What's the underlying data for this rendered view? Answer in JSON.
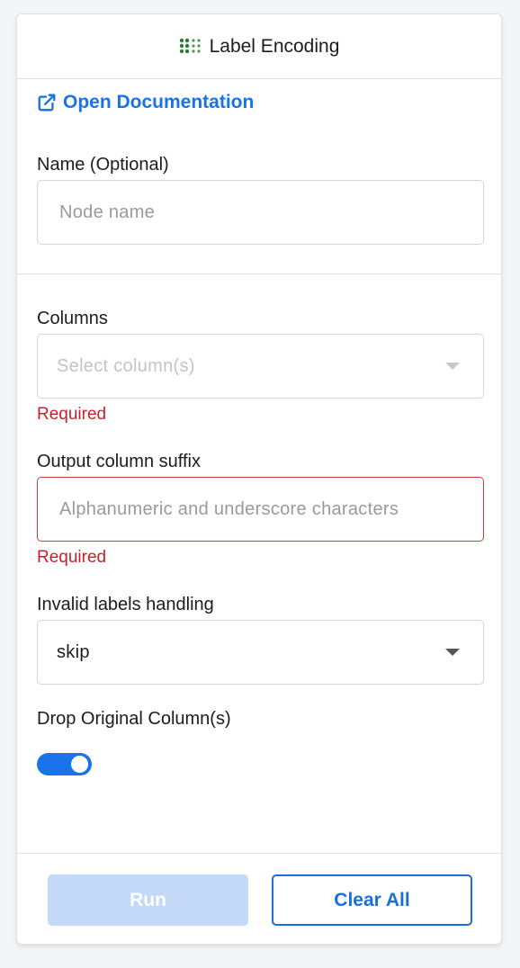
{
  "header": {
    "title": "Label Encoding",
    "icon": "grid-dots-icon",
    "icon_color": "#2e7d32"
  },
  "documentation": {
    "label": "Open Documentation",
    "icon": "external-link-icon"
  },
  "name_field": {
    "label": "Name (Optional)",
    "placeholder": "Node name",
    "value": ""
  },
  "columns_field": {
    "label": "Columns",
    "placeholder": "Select column(s)",
    "error": "Required"
  },
  "suffix_field": {
    "label": "Output column suffix",
    "placeholder": "Alphanumeric and underscore characters",
    "value": "",
    "error": "Required"
  },
  "invalid_labels_field": {
    "label": "Invalid labels handling",
    "value": "skip"
  },
  "drop_original": {
    "label": "Drop Original Column(s)",
    "enabled": true
  },
  "buttons": {
    "run": "Run",
    "clear_all": "Clear All"
  },
  "colors": {
    "accent": "#1a73e8",
    "error": "#c8202a",
    "run_disabled": "#c3d9f7"
  }
}
